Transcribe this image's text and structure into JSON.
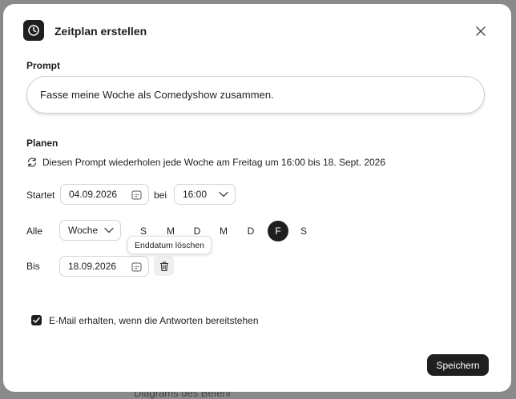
{
  "dialog": {
    "title": "Zeitplan erstellen"
  },
  "prompt": {
    "label": "Prompt",
    "value": "Fasse meine Woche als Comedyshow zusammen."
  },
  "schedule": {
    "label": "Planen",
    "summary": "Diesen Prompt wiederholen jede Woche am Freitag um 16:00 bis 18. Sept. 2026",
    "start_label": "Startet",
    "start_date": "04.09.2026",
    "at_label": "bei",
    "start_time": "16:00",
    "repeat_label": "Alle",
    "repeat_unit": "Woche",
    "days": [
      {
        "label": "S",
        "selected": false
      },
      {
        "label": "M",
        "selected": false
      },
      {
        "label": "D",
        "selected": false
      },
      {
        "label": "M",
        "selected": false
      },
      {
        "label": "D",
        "selected": false
      },
      {
        "label": "F",
        "selected": true
      },
      {
        "label": "S",
        "selected": false
      }
    ],
    "end_label": "Bis",
    "end_date": "18.09.2026",
    "clear_tooltip": "Enddatum löschen"
  },
  "notification": {
    "checked": true,
    "label": "E-Mail erhalten, wenn die Antworten bereitstehen"
  },
  "footer": {
    "save_label": "Speichern"
  },
  "backdrop": {
    "partial_text": "Diagrams des Befehl"
  },
  "colors": {
    "accent": "#1f1f1f",
    "backdrop": "#8a8a8a"
  }
}
